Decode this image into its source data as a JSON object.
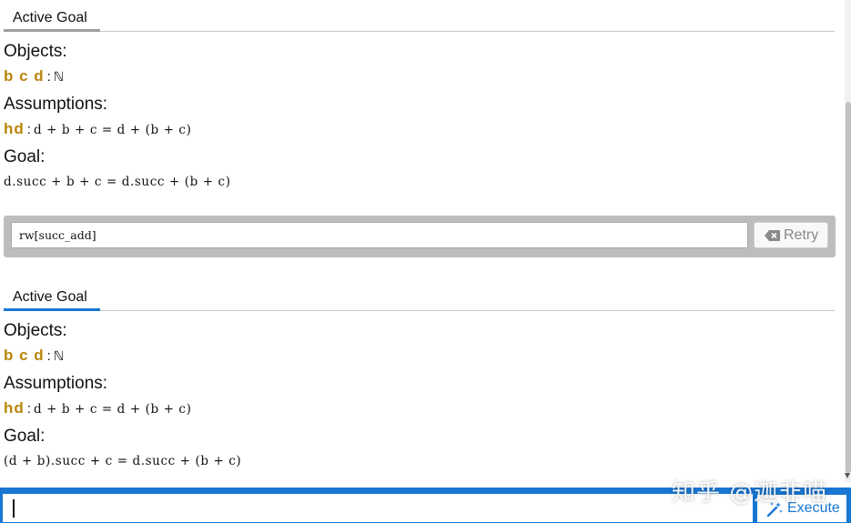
{
  "goal1": {
    "tab_label": "Active Goal",
    "objects_label": "Objects:",
    "objects_vars": "b c d",
    "objects_colon": ":",
    "objects_type": "ℕ",
    "assumptions_label": "Assumptions:",
    "hyp_name": "hd",
    "hyp_colon": ":",
    "hyp_expr": "d + b + c = d + (b + c)",
    "goal_label": "Goal:",
    "goal_expr": "d.succ + b + c = d.succ + (b + c)"
  },
  "command": {
    "text": "rw[succ_add]",
    "retry_label": "Retry"
  },
  "goal2": {
    "tab_label": "Active Goal",
    "objects_label": "Objects:",
    "objects_vars": "b c d",
    "objects_colon": ":",
    "objects_type": "ℕ",
    "assumptions_label": "Assumptions:",
    "hyp_name": "hd",
    "hyp_colon": ":",
    "hyp_expr": "d + b + c = d + (b + c)",
    "goal_label": "Goal:",
    "goal_expr": "(d + b).succ + c = d.succ + (b + c)"
  },
  "input": {
    "value": "",
    "execute_label": "Execute"
  },
  "watermark": "知乎 @迦非喵",
  "colors": {
    "accent": "#1976d2",
    "tab_inactive": "#9e9e9e",
    "variable": "#b8860b",
    "panel_gray": "#bdbdbd"
  }
}
